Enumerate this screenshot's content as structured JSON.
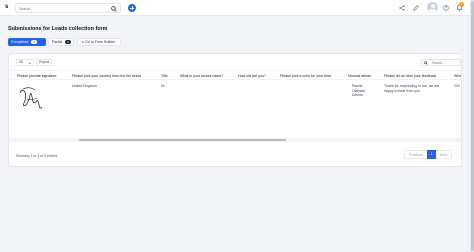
{
  "app": {
    "logo_text": "s"
  },
  "search": {
    "placeholder": "Search..."
  },
  "page": {
    "title": "Submissions for Leads collection form"
  },
  "tabs": [
    {
      "label": "Completed",
      "count": "3"
    },
    {
      "label": "Partial",
      "count": "0"
    }
  ],
  "goto_button": {
    "label": "Go to Form Builder"
  },
  "notifications": {
    "count": "1"
  },
  "table": {
    "rows_per_page": "25",
    "export_label": "Export",
    "search_placeholder": "Search...",
    "columns": [
      "Please provide signature",
      "Please pick your country from the list below",
      "Title",
      "What is your school name?",
      "How old are you?",
      "Please pick a color for your item",
      "Musical artists",
      "Please let us hear your feedback",
      "Whe"
    ],
    "row": {
      "country": "United Kingdom",
      "title": "Dr",
      "artists": [
        "Pianist",
        "Olamide",
        "Davido"
      ],
      "feedback": [
        "Thank for responding to me, we are",
        "happy to hear from you"
      ],
      "date": "202"
    }
  },
  "footer": {
    "showing": "Showing 1 to 3 of 3 entries",
    "previous": "Previous",
    "page": "1",
    "next": "Next"
  },
  "colors": {
    "primary": "#2563eb",
    "badge": "#f59e0b",
    "background": "#f1f3f6"
  }
}
